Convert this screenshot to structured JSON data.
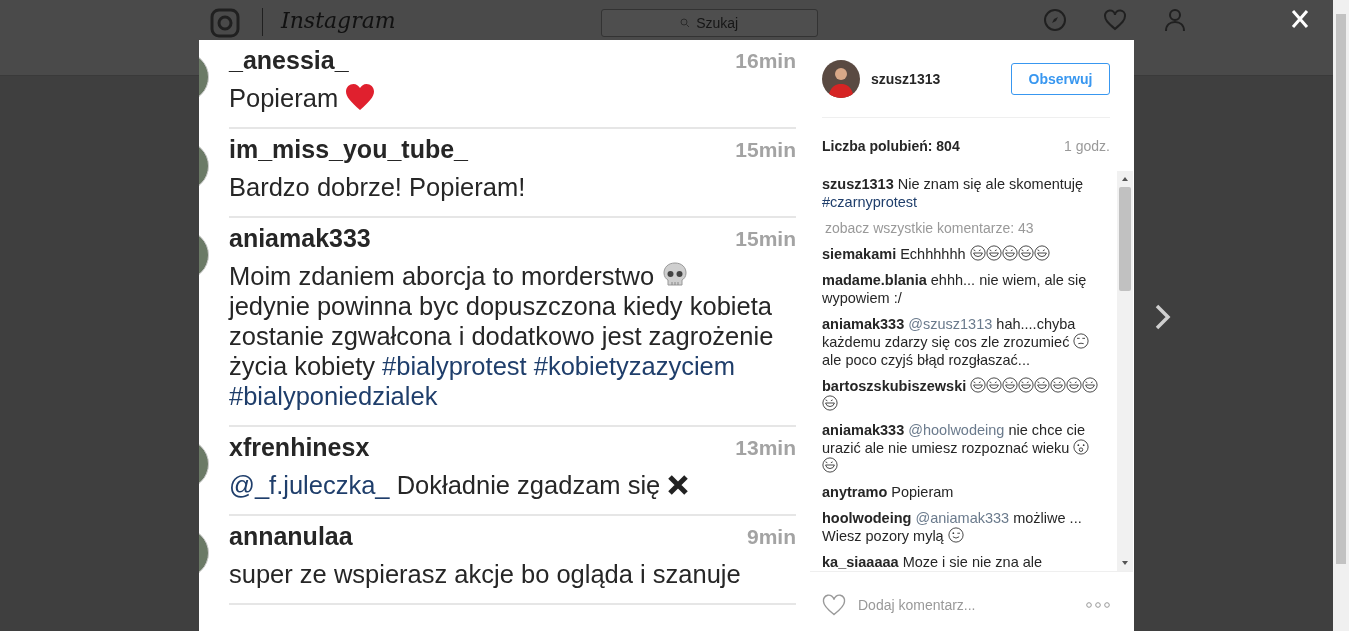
{
  "background": {
    "logo": "Instagram",
    "search": {
      "placeholder": "Szukaj"
    }
  },
  "post_image": {
    "kind": "screenshot",
    "comments": [
      {
        "user": "_anessia_",
        "time": "16min",
        "body": [
          {
            "kind": "text",
            "text": "Popieram "
          },
          {
            "kind": "heart"
          }
        ]
      },
      {
        "user": "im_miss_you_tube_",
        "time": "15min",
        "body": [
          {
            "kind": "text",
            "text": "Bardzo dobrze! Popieram!"
          }
        ]
      },
      {
        "user": "aniamak333",
        "time": "15min",
        "body": [
          {
            "kind": "text",
            "text": "Moim zdaniem aborcja to morderstwo "
          },
          {
            "kind": "skull"
          },
          {
            "kind": "break"
          },
          {
            "kind": "text",
            "text": "jedynie powinna byc dopuszczona kiedy kobieta zostanie zgwałcona i dodatkowo jest zagrożenie życia kobiety "
          },
          {
            "kind": "tag",
            "text": "#bialyprotest"
          },
          {
            "kind": "tag",
            "text": "#kobietyzazyciem"
          },
          {
            "kind": "tag",
            "text": "#bialyponiedzialek"
          }
        ]
      },
      {
        "user": "xfrenhinesx",
        "time": "13min",
        "body": [
          {
            "kind": "tag",
            "text": "@_f.juleczka_"
          },
          {
            "kind": "text",
            "text": " Dokładnie zgadzam się "
          },
          {
            "kind": "cross"
          }
        ]
      },
      {
        "user": "annanulaa",
        "time": "9min",
        "body": [
          {
            "kind": "text",
            "text": "super ze wspierasz akcje bo ogląda i szanuje"
          }
        ]
      }
    ]
  },
  "author": {
    "username": "szusz1313",
    "follow_button": "Obserwuj"
  },
  "likes": "Liczba polubień: 804",
  "age": "1 godz.",
  "caption": {
    "user": "szusz1313",
    "body": [
      {
        "kind": "text",
        "text": " Nie znam się ale skomentuję "
      },
      {
        "kind": "tag",
        "text": "#czarnyprotest"
      }
    ]
  },
  "view_all": "zobacz wszystkie komentarze: 43",
  "comments": [
    {
      "user": "siemakami",
      "body": [
        {
          "kind": "text",
          "text": " Echhhhhh "
        },
        {
          "kind": "laugh"
        },
        {
          "kind": "laugh"
        },
        {
          "kind": "laugh"
        },
        {
          "kind": "laugh"
        },
        {
          "kind": "laugh"
        }
      ]
    },
    {
      "user": "madame.blania",
      "body": [
        {
          "kind": "text",
          "text": " ehhh... nie wiem, ale się wypowiem :/"
        }
      ]
    },
    {
      "user": "aniamak333",
      "body": [
        {
          "kind": "mention",
          "text": "@szusz1313"
        },
        {
          "kind": "text",
          "text": " hah....chyba każdemu zdarzy się cos zle zrozumieć "
        },
        {
          "kind": "smirk"
        },
        {
          "kind": "text",
          "text": " ale poco czyjś błąd rozgłaszać..."
        }
      ]
    },
    {
      "user": "bartoszskubiszewski",
      "body": [
        {
          "kind": "laugh"
        },
        {
          "kind": "laugh"
        },
        {
          "kind": "laugh"
        },
        {
          "kind": "laugh"
        },
        {
          "kind": "laugh"
        },
        {
          "kind": "laugh"
        },
        {
          "kind": "laugh"
        },
        {
          "kind": "laugh"
        },
        {
          "kind": "laugh"
        }
      ]
    },
    {
      "user": "aniamak333",
      "body": [
        {
          "kind": "mention",
          "text": "@hoolwodeing"
        },
        {
          "kind": "text",
          "text": " nie chce cie urazić ale nie umiesz rozpoznać wieku "
        },
        {
          "kind": "shocked"
        },
        {
          "kind": "laugh"
        }
      ]
    },
    {
      "user": "anytramo",
      "body": [
        {
          "kind": "text",
          "text": " Popieram"
        }
      ]
    },
    {
      "user": "hoolwodeing",
      "body": [
        {
          "kind": "mention",
          "text": "@aniamak333"
        },
        {
          "kind": "text",
          "text": " możliwe ... Wiesz pozory mylą "
        },
        {
          "kind": "wink"
        }
      ]
    },
    {
      "user": "ka_siaaaaa",
      "body": [
        {
          "kind": "text",
          "text": " Moze i sie nie zna ale"
        }
      ]
    }
  ],
  "add_comment": {
    "placeholder": "Dodaj komentarz..."
  }
}
